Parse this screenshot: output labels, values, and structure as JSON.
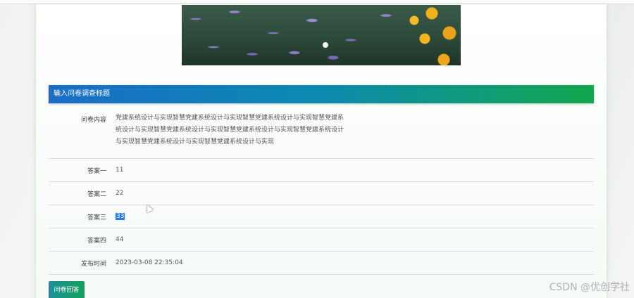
{
  "section": {
    "title": "输入问卷调查标题"
  },
  "fields": [
    {
      "label": "问卷内容",
      "value": "党建系统设计与实现智慧党建系统设计与实现智慧党建系统设计与实现智慧党建系统设计与实现智慧党建系统设计与实现智慧党建系统设计与实现智慧党建系统设计与实现智慧党建系统设计与实现智慧党建系统设计与实现"
    },
    {
      "label": "答案一",
      "value": "11"
    },
    {
      "label": "答案二",
      "value": "22"
    },
    {
      "label": "答案三",
      "value": "33"
    },
    {
      "label": "答案四",
      "value": "44"
    },
    {
      "label": "发布时间",
      "value": "2023-03-08 22:35:04"
    }
  ],
  "actions": {
    "answer_label": "问卷回答"
  },
  "watermark": "CSDN @优创学社",
  "icons": {
    "cursor": "mouse-pointer-icon"
  },
  "colors": {
    "header_start": "#1a6ec8",
    "header_end": "#11a84e",
    "selection": "#2b78e4"
  }
}
